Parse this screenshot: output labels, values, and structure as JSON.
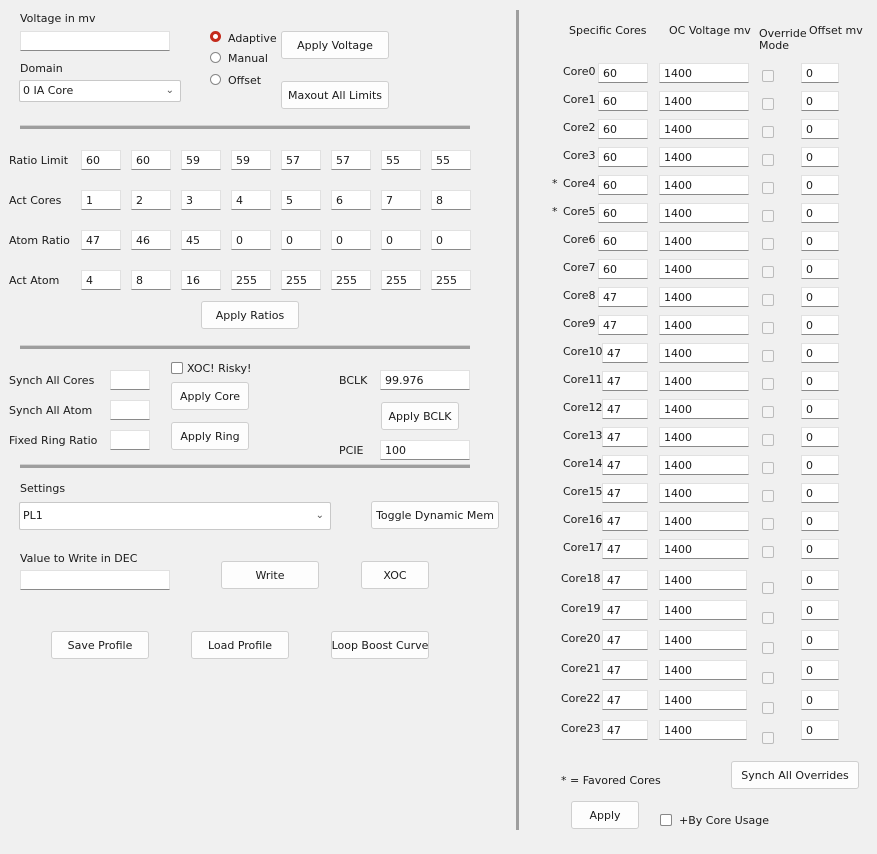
{
  "voltage": {
    "label": "Voltage in mv",
    "value": "",
    "modes": [
      "Adaptive",
      "Manual",
      "Offset"
    ],
    "selected_mode": "Adaptive",
    "apply_label": "Apply Voltage",
    "maxout_label": "Maxout All Limits"
  },
  "domain": {
    "label": "Domain",
    "selected": "0 IA Core"
  },
  "ratio_table": {
    "rows": [
      {
        "label": "Ratio Limit",
        "values": [
          "60",
          "60",
          "59",
          "59",
          "57",
          "57",
          "55",
          "55"
        ]
      },
      {
        "label": "Act Cores",
        "values": [
          "1",
          "2",
          "3",
          "4",
          "5",
          "6",
          "7",
          "8"
        ]
      },
      {
        "label": "Atom Ratio",
        "values": [
          "47",
          "46",
          "45",
          "0",
          "0",
          "0",
          "0",
          "0"
        ]
      },
      {
        "label": "Act Atom",
        "values": [
          "4",
          "8",
          "16",
          "255",
          "255",
          "255",
          "255",
          "255"
        ]
      }
    ],
    "apply_label": "Apply Ratios"
  },
  "synch": {
    "all_cores_label": "Synch All Cores",
    "all_cores_value": "",
    "all_atom_label": "Synch All Atom",
    "all_atom_value": "",
    "ring_label": "Fixed Ring Ratio",
    "ring_value": "",
    "xoc_label": "XOC! Risky!",
    "apply_core_label": "Apply Core",
    "apply_ring_label": "Apply Ring"
  },
  "bclk": {
    "label": "BCLK",
    "value": "99.976",
    "apply_label": "Apply BCLK",
    "pcie_label": "PCIE",
    "pcie_value": "100"
  },
  "settings": {
    "label": "Settings",
    "selected": "PL1",
    "toggle_label": "Toggle Dynamic Mem"
  },
  "write": {
    "label": "Value to Write in DEC",
    "value": "",
    "write_label": "Write",
    "xoc_label": "XOC"
  },
  "profile": {
    "save_label": "Save Profile",
    "load_label": "Load Profile",
    "loop_label": "Loop Boost Curve"
  },
  "cores_panel": {
    "headers": {
      "cores": "Specific Cores",
      "voltage": "OC Voltage mv",
      "override": "Override\nMode",
      "offset": "Offset mv"
    },
    "cores": [
      {
        "name": "Core0",
        "favored": false,
        "ratio": "60",
        "voltage": "1400",
        "offset": "0"
      },
      {
        "name": "Core1",
        "favored": false,
        "ratio": "60",
        "voltage": "1400",
        "offset": "0"
      },
      {
        "name": "Core2",
        "favored": false,
        "ratio": "60",
        "voltage": "1400",
        "offset": "0"
      },
      {
        "name": "Core3",
        "favored": false,
        "ratio": "60",
        "voltage": "1400",
        "offset": "0"
      },
      {
        "name": "Core4",
        "favored": true,
        "ratio": "60",
        "voltage": "1400",
        "offset": "0"
      },
      {
        "name": "Core5",
        "favored": true,
        "ratio": "60",
        "voltage": "1400",
        "offset": "0"
      },
      {
        "name": "Core6",
        "favored": false,
        "ratio": "60",
        "voltage": "1400",
        "offset": "0"
      },
      {
        "name": "Core7",
        "favored": false,
        "ratio": "60",
        "voltage": "1400",
        "offset": "0"
      },
      {
        "name": "Core8",
        "favored": false,
        "ratio": "47",
        "voltage": "1400",
        "offset": "0"
      },
      {
        "name": "Core9",
        "favored": false,
        "ratio": "47",
        "voltage": "1400",
        "offset": "0"
      },
      {
        "name": "Core10",
        "favored": false,
        "ratio": "47",
        "voltage": "1400",
        "offset": "0"
      },
      {
        "name": "Core11",
        "favored": false,
        "ratio": "47",
        "voltage": "1400",
        "offset": "0"
      },
      {
        "name": "Core12",
        "favored": false,
        "ratio": "47",
        "voltage": "1400",
        "offset": "0"
      },
      {
        "name": "Core13",
        "favored": false,
        "ratio": "47",
        "voltage": "1400",
        "offset": "0"
      },
      {
        "name": "Core14",
        "favored": false,
        "ratio": "47",
        "voltage": "1400",
        "offset": "0"
      },
      {
        "name": "Core15",
        "favored": false,
        "ratio": "47",
        "voltage": "1400",
        "offset": "0"
      },
      {
        "name": "Core16",
        "favored": false,
        "ratio": "47",
        "voltage": "1400",
        "offset": "0"
      },
      {
        "name": "Core17",
        "favored": false,
        "ratio": "47",
        "voltage": "1400",
        "offset": "0"
      },
      {
        "name": "Core18",
        "favored": false,
        "ratio": "47",
        "voltage": "1400",
        "offset": "0"
      },
      {
        "name": "Core19",
        "favored": false,
        "ratio": "47",
        "voltage": "1400",
        "offset": "0"
      },
      {
        "name": "Core20",
        "favored": false,
        "ratio": "47",
        "voltage": "1400",
        "offset": "0"
      },
      {
        "name": "Core21",
        "favored": false,
        "ratio": "47",
        "voltage": "1400",
        "offset": "0"
      },
      {
        "name": "Core22",
        "favored": false,
        "ratio": "47",
        "voltage": "1400",
        "offset": "0"
      },
      {
        "name": "Core23",
        "favored": false,
        "ratio": "47",
        "voltage": "1400",
        "offset": "0"
      }
    ],
    "favored_note": "* = Favored Cores",
    "synch_overrides_label": "Synch All Overrides",
    "apply_label": "Apply",
    "by_core_usage_label": "+By Core Usage"
  },
  "colors": {
    "accent": "#c42b1c",
    "window_bg": "#f0f0f0"
  }
}
